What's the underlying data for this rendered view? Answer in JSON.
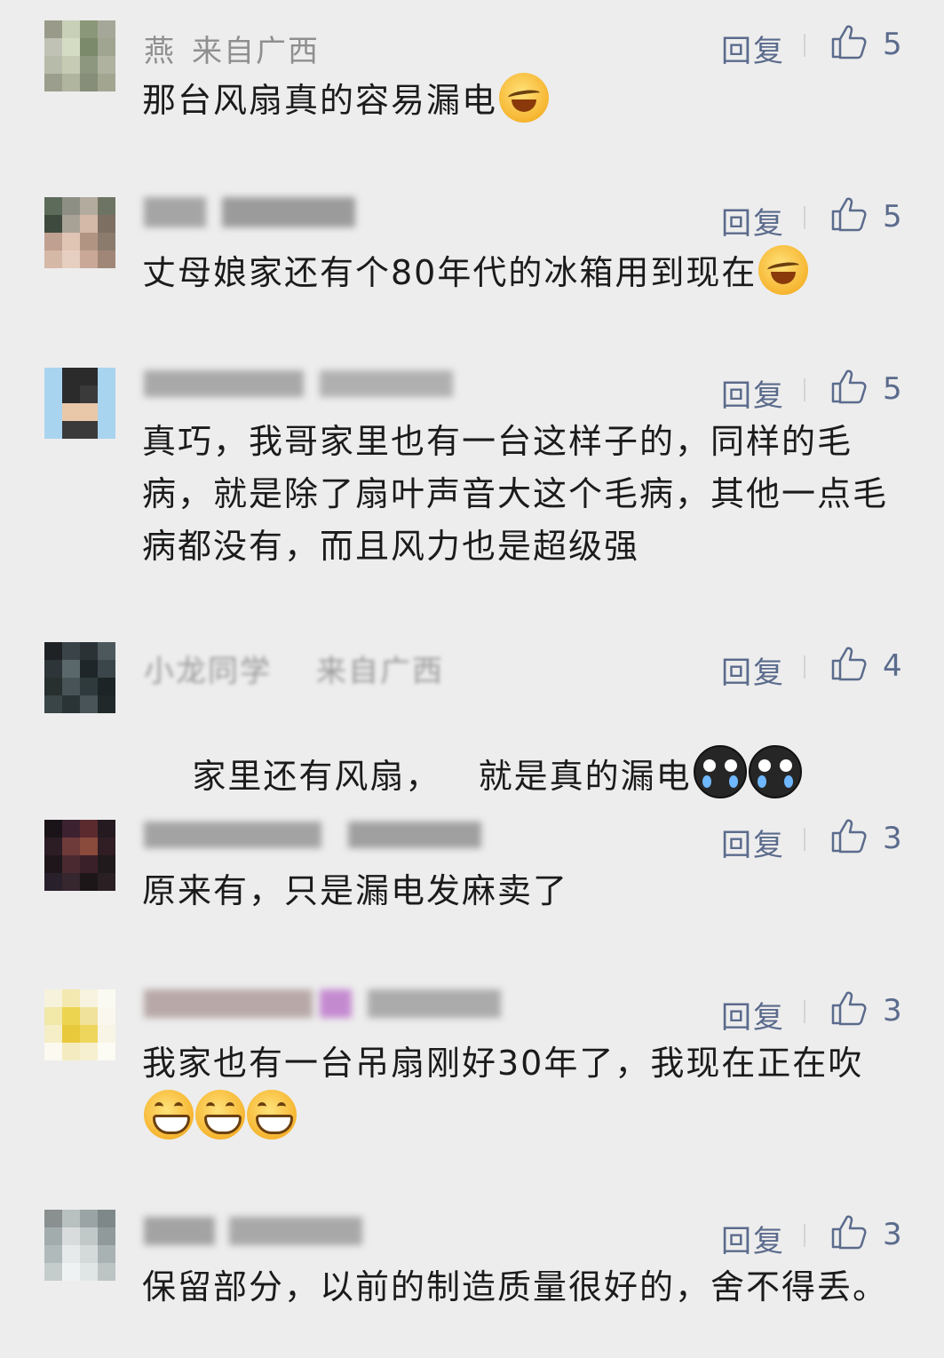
{
  "reply_label": "回复",
  "comments": [
    {
      "name": "燕",
      "location": "来自广西",
      "name_blurred": false,
      "text": "那台风扇真的容易漏电",
      "emojis": [
        "laugh-cry-emoji"
      ],
      "likes": "5",
      "avatar_colors": [
        "#9a9a8a",
        "#c9d0b8",
        "#8b9779",
        "#a5a898",
        "#bfc2b4",
        "#d5dcc4",
        "#7c8a6c",
        "#9fa590",
        "#b7bba9",
        "#c6cbb4",
        "#8d9780",
        "#aeb29f",
        "#9b9e8c",
        "#b0b5a0",
        "#868d78",
        "#a2a690"
      ]
    },
    {
      "name": "",
      "location": "",
      "name_blurred": true,
      "text": "丈母娘家还有个80年代的冰箱用到现在",
      "emojis": [
        "laugh-cry-emoji"
      ],
      "likes": "5",
      "avatar_colors": [
        "#5d6b5a",
        "#8d8f84",
        "#b3ab9d",
        "#6e7463",
        "#3e4a3d",
        "#a8a296",
        "#d4b9a8",
        "#7d6f62",
        "#c0a090",
        "#e0c4b4",
        "#b29483",
        "#8a7b6d",
        "#d6b8a6",
        "#e6cfc0",
        "#c9a898",
        "#a08677"
      ]
    },
    {
      "name": "",
      "location": "",
      "name_blurred": true,
      "text": "真巧，我哥家里也有一台这样子的，同样的毛病，就是除了扇叶声音大这个毛病，其他一点毛病都没有，而且风力也是超级强",
      "emojis": [],
      "likes": "5",
      "avatar_colors": [
        "#a8d4f0",
        "#2b2b2b",
        "#2b2b2b",
        "#a8d4f0",
        "#a8d4f0",
        "#2b2b2b",
        "#3a3a3a",
        "#a8d4f0",
        "#a8d4f0",
        "#e8c8a8",
        "#e8c8a8",
        "#a8d4f0",
        "#a8d4f0",
        "#3a3a3a",
        "#3a3a3a",
        "#a8d4f0"
      ]
    },
    {
      "name": "小龙同学",
      "location": "来自广西",
      "name_blurred": true,
      "text": "家里还有风扇，   就是真的漏电",
      "emojis": [
        "crying-emoji",
        "crying-emoji"
      ],
      "likes": "4",
      "avatar_colors": [
        "#1e2224",
        "#3a4448",
        "#2a3236",
        "#4c585c",
        "#2d3539",
        "#5a676b",
        "#1f2629",
        "#3b464a",
        "#27302f",
        "#475356",
        "#2e3a3c",
        "#1c2426",
        "#3a4548",
        "#2a3335",
        "#485457",
        "#202829"
      ]
    },
    {
      "name": "",
      "location": "",
      "name_blurred": true,
      "text": "原来有，只是漏电发麻卖了",
      "emojis": [],
      "likes": "3",
      "avatar_colors": [
        "#1a1418",
        "#3c2230",
        "#5a2a2e",
        "#241a20",
        "#2c1c24",
        "#6e3a3a",
        "#8a4a3c",
        "#301e24",
        "#1e161a",
        "#4a2a30",
        "#3a2028",
        "#201a1c",
        "#28202a",
        "#36262e",
        "#1c1618",
        "#2a2024"
      ]
    },
    {
      "name": "",
      "location": "",
      "name_blurred": true,
      "text": "我家也有一台吊扇刚好30年了，我现在正在吹",
      "emojis": [
        "grin-emoji",
        "grin-emoji",
        "grin-emoji"
      ],
      "likes": "3",
      "avatar_colors": [
        "#f6f2dc",
        "#f3e9b0",
        "#f7f3e0",
        "#fbfaf2",
        "#f2e8a8",
        "#ecd450",
        "#f0e29a",
        "#faf8ee",
        "#f5eec6",
        "#e9c93c",
        "#eed65c",
        "#f8f5e6",
        "#fbf9f0",
        "#f4ecc0",
        "#f6f0d0",
        "#fcfbf4"
      ]
    },
    {
      "name": "",
      "location": "",
      "name_blurred": true,
      "text": "保留部分，以前的制造质量很好的，舍不得丢。",
      "emojis": [],
      "likes": "3",
      "avatar_colors": [
        "#8a9090",
        "#b8c0c0",
        "#9aa4a4",
        "#7e8888",
        "#a2acac",
        "#d8dcdc",
        "#c0c8c8",
        "#909a9a",
        "#b0baba",
        "#e6eaea",
        "#d4dada",
        "#a8b2b2",
        "#c4cccc",
        "#eef2f2",
        "#e0e6e6",
        "#bcc4c4"
      ]
    }
  ]
}
